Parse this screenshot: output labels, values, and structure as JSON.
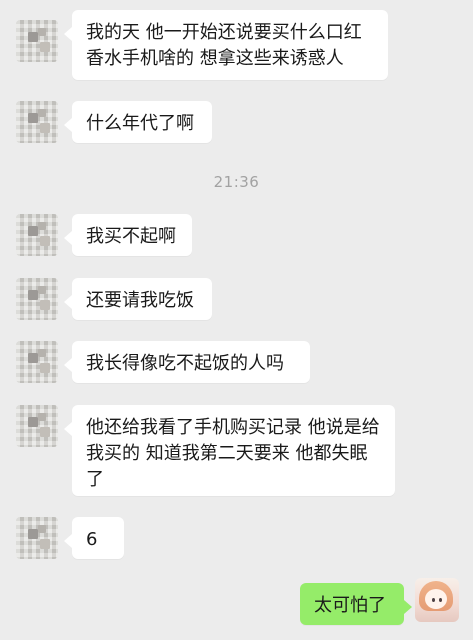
{
  "chat": {
    "time_divider": "21:36",
    "messages": [
      {
        "side": "left",
        "text": "我的天 他一开始还说要买什么口红香水手机啥的 想拿这些来诱惑人"
      },
      {
        "side": "left",
        "text": "什么年代了啊"
      },
      {
        "side": "left",
        "text": "我买不起啊"
      },
      {
        "side": "left",
        "text": "还要请我吃饭"
      },
      {
        "side": "left",
        "text": "我长得像吃不起饭的人吗"
      },
      {
        "side": "left",
        "text": "他还给我看了手机购买记录 他说是给我买的 知道我第二天要来 他都失眠了"
      },
      {
        "side": "left",
        "text": "6"
      },
      {
        "side": "right",
        "text": "太可怕了"
      }
    ]
  },
  "colors": {
    "background": "#ececec",
    "incoming_bubble": "#ffffff",
    "outgoing_bubble": "#95ec69",
    "timestamp_text": "#a2a2a2"
  },
  "icons": {
    "left_avatar": "blurred-avatar-icon",
    "right_avatar": "anime-girl-avatar-icon"
  }
}
